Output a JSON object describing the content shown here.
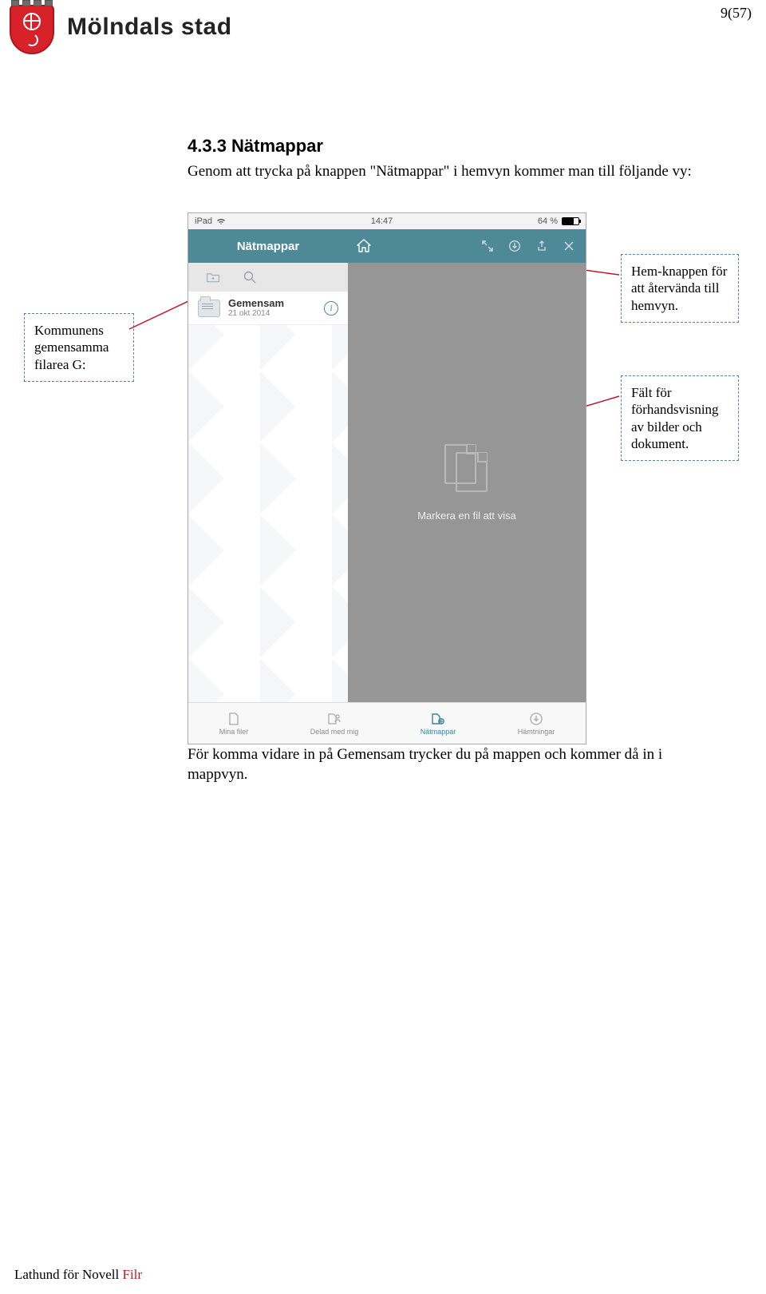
{
  "page_number": "9(57)",
  "brand": "Mölndals stad",
  "section": {
    "heading": "4.3.3 Nätmappar",
    "intro": "Genom att trycka på knappen \"Nätmappar\" i hemvyn kommer man till följande vy:",
    "after": "För komma vidare in på Gemensam trycker du på mappen och kommer då in i mappvyn."
  },
  "callouts": {
    "left": "Kommunens gemensamma filarea G:",
    "right_top": "Hem-knappen för att återvända till hemvyn.",
    "right_bottom": "Fält för förhandsvisning av bilder och dokument."
  },
  "screenshot": {
    "status": {
      "device": "iPad",
      "time": "14:47",
      "battery": "64 %"
    },
    "appbar": {
      "title": "Nätmappar"
    },
    "list": {
      "items": [
        {
          "title": "Gemensam",
          "subtitle": "21 okt 2014"
        }
      ]
    },
    "preview_caption": "Markera en fil att visa",
    "tabs": {
      "items": [
        {
          "label": "Mina filer"
        },
        {
          "label": "Delad med mig"
        },
        {
          "label": "Nätmappar"
        },
        {
          "label": "Hämtningar"
        }
      ],
      "active_index": 2
    }
  },
  "footer": {
    "prefix": "Lathund för Novell ",
    "product": "Filr"
  }
}
